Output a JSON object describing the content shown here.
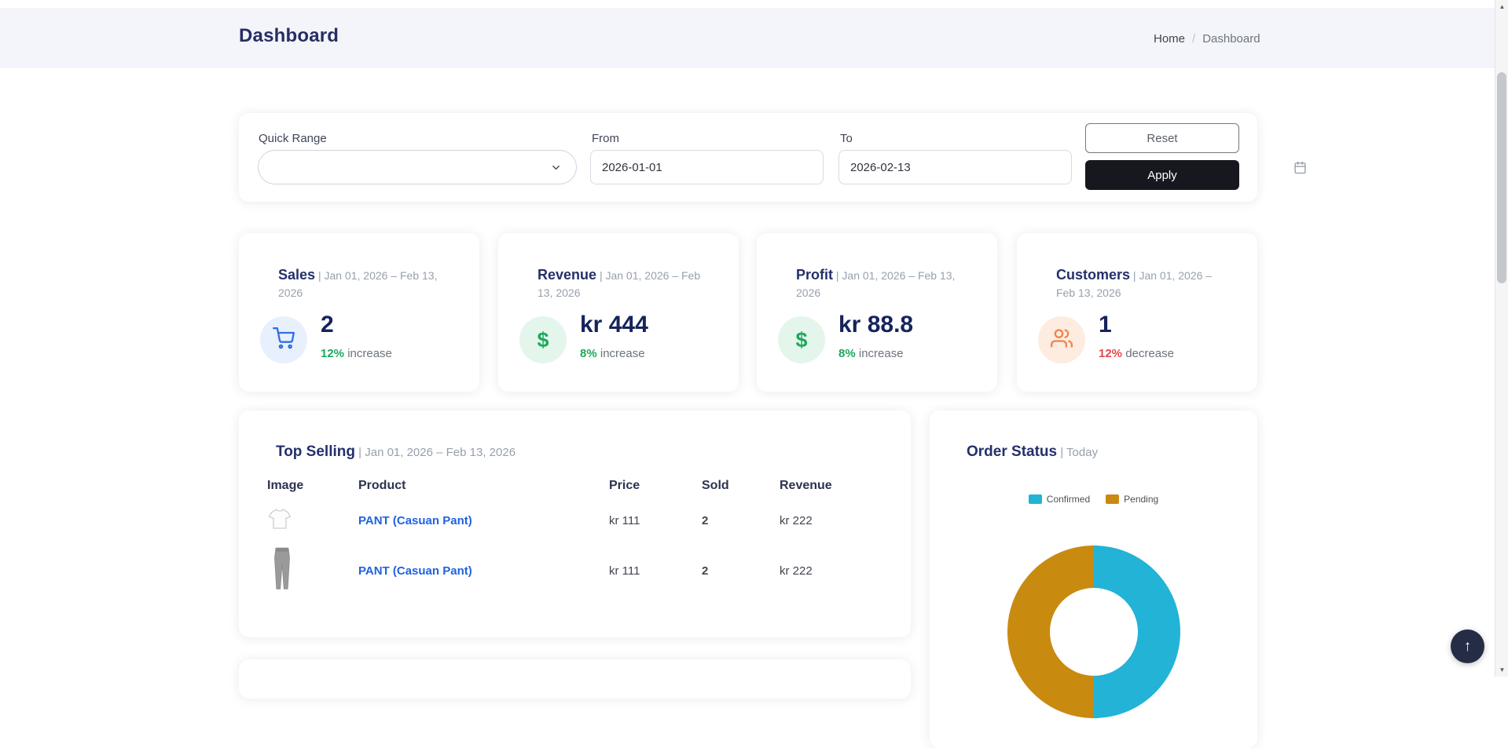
{
  "header": {
    "title": "Dashboard",
    "breadcrumb": {
      "items": [
        "Home",
        "Dashboard"
      ],
      "separator": "/"
    }
  },
  "filters": {
    "quick_range": {
      "label": "Quick Range",
      "value": ""
    },
    "from": {
      "label": "From",
      "value": "2026-01-01"
    },
    "to": {
      "label": "To",
      "value": "2026-02-13"
    },
    "reset_label": "Reset",
    "apply_label": "Apply"
  },
  "stats": [
    {
      "title": "Sales",
      "period": "| Jan 01, 2026 – Feb 13, 2026",
      "value": "2",
      "delta": "12%",
      "direction": "increase",
      "icon": "shopping-cart-icon",
      "icon_color": "#2f6fe4",
      "icon_bg": "#e9f0fd",
      "delta_color": "#1ca95c"
    },
    {
      "title": "Revenue",
      "period": "| Jan 01, 2026 – Feb 13, 2026",
      "value": "kr 444",
      "delta": "8%",
      "direction": "increase",
      "icon": "dollar-icon",
      "icon_color": "#1ca95c",
      "icon_bg": "#e4f6ec",
      "delta_color": "#1ca95c"
    },
    {
      "title": "Profit",
      "period": "| Jan 01, 2026 – Feb 13, 2026",
      "value": "kr 88.8",
      "delta": "8%",
      "direction": "increase",
      "icon": "dollar-icon",
      "icon_color": "#1ca95c",
      "icon_bg": "#e4f6ec",
      "delta_color": "#1ca95c"
    },
    {
      "title": "Customers",
      "period": "| Jan 01, 2026 – Feb 13, 2026",
      "value": "1",
      "delta": "12%",
      "direction": "decrease",
      "icon": "users-icon",
      "icon_color": "#ef8450",
      "icon_bg": "#fdecdf",
      "delta_color": "#e5484d"
    }
  ],
  "top_selling": {
    "title": "Top Selling",
    "period": "| Jan 01, 2026 – Feb 13, 2026",
    "columns": [
      "Image",
      "Product",
      "Price",
      "Sold",
      "Revenue"
    ],
    "rows": [
      {
        "image": "tshirt-thumbnail",
        "product": "PANT (Casuan Pant)",
        "price": "kr 111",
        "sold": "2",
        "revenue": "kr 222"
      },
      {
        "image": "pants-thumbnail",
        "product": "PANT (Casuan Pant)",
        "price": "kr 111",
        "sold": "2",
        "revenue": "kr 222"
      }
    ]
  },
  "order_status": {
    "title": "Order Status",
    "period": "| Today",
    "legend": [
      {
        "label": "Confirmed",
        "color": "#22b3d6"
      },
      {
        "label": "Pending",
        "color": "#c98a10"
      }
    ]
  },
  "chart_data": {
    "type": "pie",
    "donut": true,
    "title": "Order Status | Today",
    "categories": [
      "Confirmed",
      "Pending"
    ],
    "values": [
      50,
      50
    ],
    "colors": [
      "#22b3d6",
      "#c98a10"
    ],
    "legend_position": "top"
  },
  "icons": {
    "scroll_top": "↑",
    "scrollbar_up": "▲",
    "scrollbar_down": "▼"
  }
}
